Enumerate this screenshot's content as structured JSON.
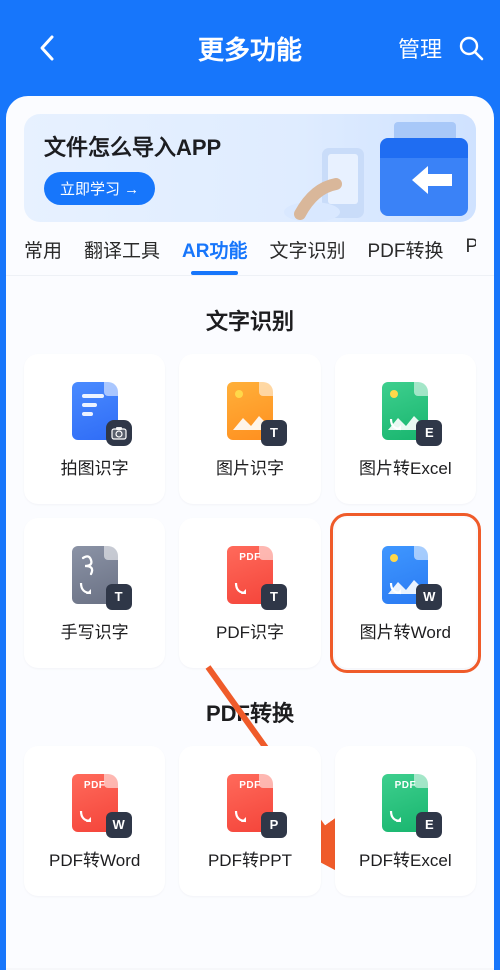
{
  "header": {
    "title": "更多功能",
    "manage_label": "管理"
  },
  "banner": {
    "title": "文件怎么导入APP",
    "button_label": "立即学习 →"
  },
  "tabs": [
    {
      "label": "常用",
      "active": false
    },
    {
      "label": "翻译工具",
      "active": false
    },
    {
      "label": "AR功能",
      "active": true
    },
    {
      "label": "文字识别",
      "active": false
    },
    {
      "label": "PDF转换",
      "active": false
    },
    {
      "label": "PI",
      "active": false,
      "cut": true
    }
  ],
  "sections": [
    {
      "title": "文字识别",
      "items": [
        {
          "label": "拍图识字",
          "name": "camera-ocr",
          "icon": {
            "color": "c-blue",
            "type": "doc-camera",
            "badge": ""
          }
        },
        {
          "label": "图片识字",
          "name": "image-ocr",
          "icon": {
            "color": "c-orange",
            "type": "image",
            "badge": "T"
          }
        },
        {
          "label": "图片转Excel",
          "name": "image-to-excel",
          "icon": {
            "color": "c-green",
            "type": "image",
            "badge": "E"
          }
        },
        {
          "label": "手写识字",
          "name": "handwriting-ocr",
          "icon": {
            "color": "c-gray",
            "type": "script",
            "badge": "T"
          }
        },
        {
          "label": "PDF识字",
          "name": "pdf-ocr",
          "icon": {
            "color": "c-red",
            "type": "pdf",
            "badge": "T"
          }
        },
        {
          "label": "图片转Word",
          "name": "image-to-word",
          "icon": {
            "color": "c-blue2",
            "type": "image",
            "badge": "W"
          },
          "highlight": true
        }
      ]
    },
    {
      "title": "PDF转换",
      "items": [
        {
          "label": "PDF转Word",
          "name": "pdf-to-word",
          "icon": {
            "color": "c-red",
            "type": "pdf",
            "badge": "W"
          }
        },
        {
          "label": "PDF转PPT",
          "name": "pdf-to-ppt",
          "icon": {
            "color": "c-red",
            "type": "pdf",
            "badge": "P"
          }
        },
        {
          "label": "PDF转Excel",
          "name": "pdf-to-excel",
          "icon": {
            "color": "c-green",
            "type": "pdf",
            "badge": "E"
          }
        }
      ]
    }
  ]
}
